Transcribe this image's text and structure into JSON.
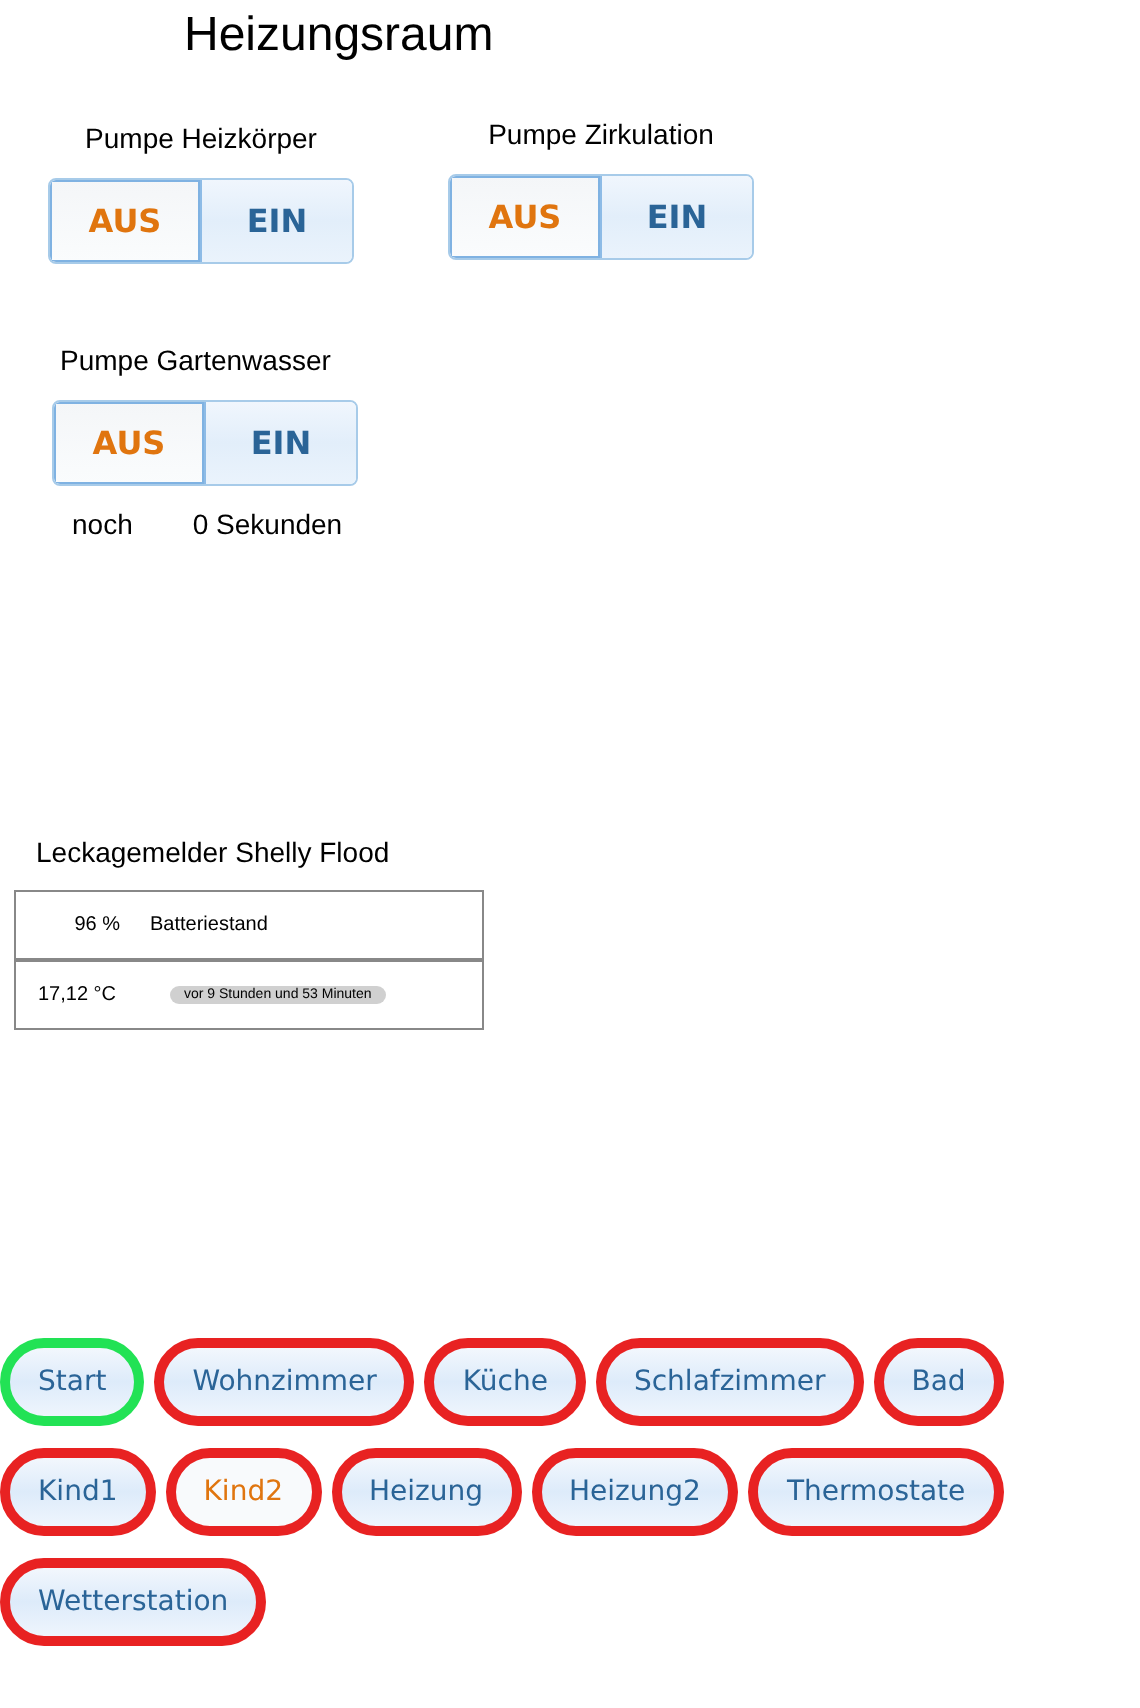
{
  "title": "Heizungsraum",
  "pumps": [
    {
      "label": "Pumpe Heizkörper",
      "options": [
        {
          "label": "AUS",
          "selected": true
        },
        {
          "label": "EIN",
          "selected": false
        }
      ]
    },
    {
      "label": "Pumpe Zirkulation",
      "options": [
        {
          "label": "AUS",
          "selected": true
        },
        {
          "label": "EIN",
          "selected": false
        }
      ]
    },
    {
      "label": "Pumpe Gartenwasser",
      "options": [
        {
          "label": "AUS",
          "selected": true
        },
        {
          "label": "EIN",
          "selected": false
        }
      ],
      "timer": {
        "prefix": "noch",
        "value": "0 Sekunden"
      }
    }
  ],
  "leak_sensor": {
    "title": "Leckagemelder Shelly Flood",
    "rows": [
      {
        "value": "96 %",
        "label": "Batteriestand",
        "kind": "text"
      },
      {
        "value": "17,12 °C",
        "label": "vor 9 Stunden und 53 Minuten",
        "kind": "pill"
      }
    ]
  },
  "nav": [
    {
      "label": "Start",
      "color": "#22e255",
      "selected": false
    },
    {
      "label": "Wohnzimmer",
      "color": "#e82222",
      "selected": false
    },
    {
      "label": "Küche",
      "color": "#e82222",
      "selected": false
    },
    {
      "label": "Schlafzimmer",
      "color": "#e82222",
      "selected": false
    },
    {
      "label": "Bad",
      "color": "#e82222",
      "selected": false
    },
    {
      "label": "Kind1",
      "color": "#e82222",
      "selected": false
    },
    {
      "label": "Kind2",
      "color": "#e82222",
      "selected": true
    },
    {
      "label": "Heizung",
      "color": "#e82222",
      "selected": false
    },
    {
      "label": "Heizung2",
      "color": "#e82222",
      "selected": false
    },
    {
      "label": "Thermostate",
      "color": "#e82222",
      "selected": false
    },
    {
      "label": "Wetterstation",
      "color": "#e82222",
      "selected": false
    }
  ]
}
